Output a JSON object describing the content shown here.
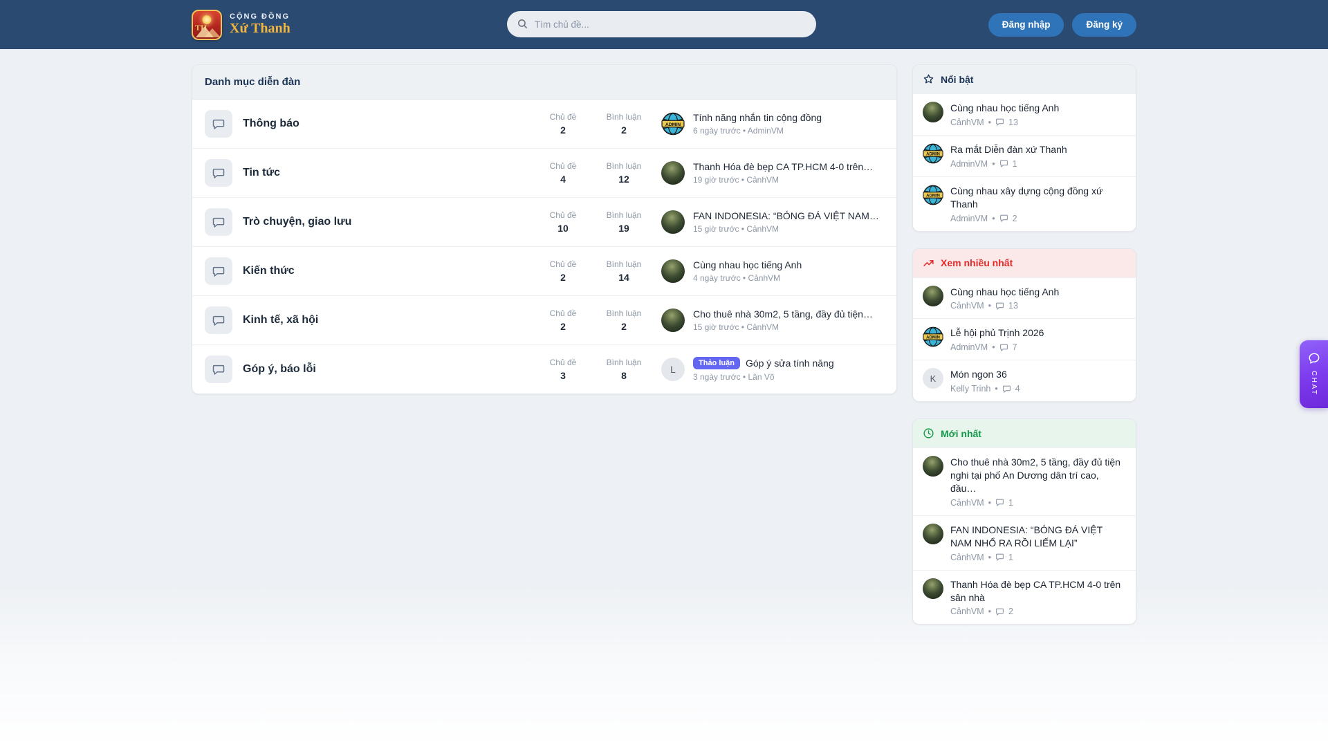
{
  "brand": {
    "community": "CỘNG ĐỒNG",
    "name": "Xứ Thanh",
    "logo_monogram": "TH"
  },
  "header": {
    "search_placeholder": "Tìm chủ đề...",
    "login_label": "Đăng nhập",
    "register_label": "Đăng ký"
  },
  "forum": {
    "title": "Danh mục diễn đàn",
    "topics_label": "Chủ đề",
    "comments_label": "Bình luận",
    "rows": [
      {
        "name": "Thông báo",
        "topics": "2",
        "comments": "2",
        "avatar": "admin",
        "latest_title": "Tính năng nhắn tin cộng đồng",
        "latest_meta": "6 ngày trước • AdminVM"
      },
      {
        "name": "Tin tức",
        "topics": "4",
        "comments": "12",
        "avatar": "photo",
        "latest_title": "Thanh Hóa đè bẹp CA TP.HCM 4-0 trên…",
        "latest_meta": "19 giờ trước • CảnhVM"
      },
      {
        "name": "Trò chuyện, giao lưu",
        "topics": "10",
        "comments": "19",
        "avatar": "photo",
        "latest_title": "FAN INDONESIA: “BÓNG ĐÁ VIỆT NAM…",
        "latest_meta": "15 giờ trước • CảnhVM"
      },
      {
        "name": "Kiến thức",
        "topics": "2",
        "comments": "14",
        "avatar": "photo",
        "latest_title": "Cùng nhau học tiếng Anh",
        "latest_meta": "4 ngày trước • CảnhVM"
      },
      {
        "name": "Kinh tế, xã hội",
        "topics": "2",
        "comments": "2",
        "avatar": "photo",
        "latest_title": "Cho thuê nhà 30m2, 5 tầng, đầy đủ tiện…",
        "latest_meta": "15 giờ trước • CảnhVM"
      },
      {
        "name": "Góp ý, báo lỗi",
        "topics": "3",
        "comments": "8",
        "avatar": "L",
        "badge": "Thảo luận",
        "latest_title": "Góp ý sửa tính năng",
        "latest_meta": "3 ngày trước • Lân Võ"
      }
    ]
  },
  "sidebar": {
    "featured": {
      "title": "Nổi bật",
      "items": [
        {
          "avatar": "photo",
          "title": "Cùng nhau học tiếng Anh",
          "author": "CảnhVM",
          "comments": "13"
        },
        {
          "avatar": "admin",
          "title": "Ra mắt Diễn đàn xứ Thanh",
          "author": "AdminVM",
          "comments": "1"
        },
        {
          "avatar": "admin",
          "title": "Cùng nhau xây dựng cộng đồng xứ Thanh",
          "author": "AdminVM",
          "comments": "2"
        }
      ]
    },
    "most_viewed": {
      "title": "Xem nhiều nhất",
      "items": [
        {
          "avatar": "photo",
          "title": "Cùng nhau học tiếng Anh",
          "author": "CảnhVM",
          "comments": "13"
        },
        {
          "avatar": "admin",
          "title": "Lễ hội phủ Trịnh 2026",
          "author": "AdminVM",
          "comments": "7"
        },
        {
          "avatar": "K",
          "title": "Món ngon 36",
          "author": "Kelly Trinh",
          "comments": "4"
        }
      ]
    },
    "newest": {
      "title": "Mới nhất",
      "items": [
        {
          "avatar": "photo",
          "title": "Cho thuê nhà 30m2, 5 tầng, đầy đủ tiện nghi tại phố An Dương dân trí cao, đầu…",
          "author": "CảnhVM",
          "comments": "1"
        },
        {
          "avatar": "photo",
          "title": "FAN INDONESIA: “BÓNG ĐÁ VIỆT NAM NHỔ RA RỒI LIẾM LẠI”",
          "author": "CảnhVM",
          "comments": "1"
        },
        {
          "avatar": "photo",
          "title": "Thanh Hóa đè bẹp CA TP.HCM 4-0 trên sân nhà",
          "author": "CảnhVM",
          "comments": "2"
        }
      ]
    }
  },
  "chat": {
    "label": "CHAT"
  },
  "colors": {
    "header_navy": "#2b4a72",
    "button_blue": "#2f74b8",
    "brand_gold": "#f2b53e",
    "badge_indigo": "#6366f1",
    "featured_navy": "#1c3557",
    "most_viewed_red": "#e02b2b",
    "newest_green": "#149a48",
    "chat_purple": "#7c3aed",
    "admin_avatar_teal": "#3ab5d8"
  }
}
